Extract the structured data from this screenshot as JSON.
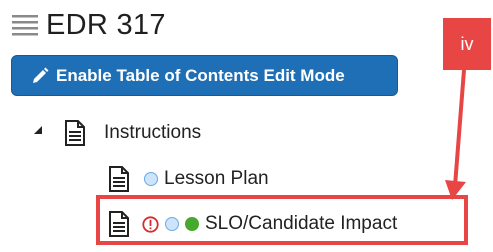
{
  "header": {
    "title": "EDR 317"
  },
  "toolbar": {
    "edit_button_label": "Enable Table of Contents Edit Mode"
  },
  "tree": {
    "items": [
      {
        "label": "Instructions"
      },
      {
        "label": "Lesson Plan"
      },
      {
        "label": "SLO/Candidate Impact"
      }
    ]
  },
  "annotation": {
    "tag_label": "iv"
  },
  "colors": {
    "button": "#1f6fb6",
    "annotation_red": "#e84545",
    "status_green": "#46a82c",
    "status_blue": "#6aa9e6"
  }
}
